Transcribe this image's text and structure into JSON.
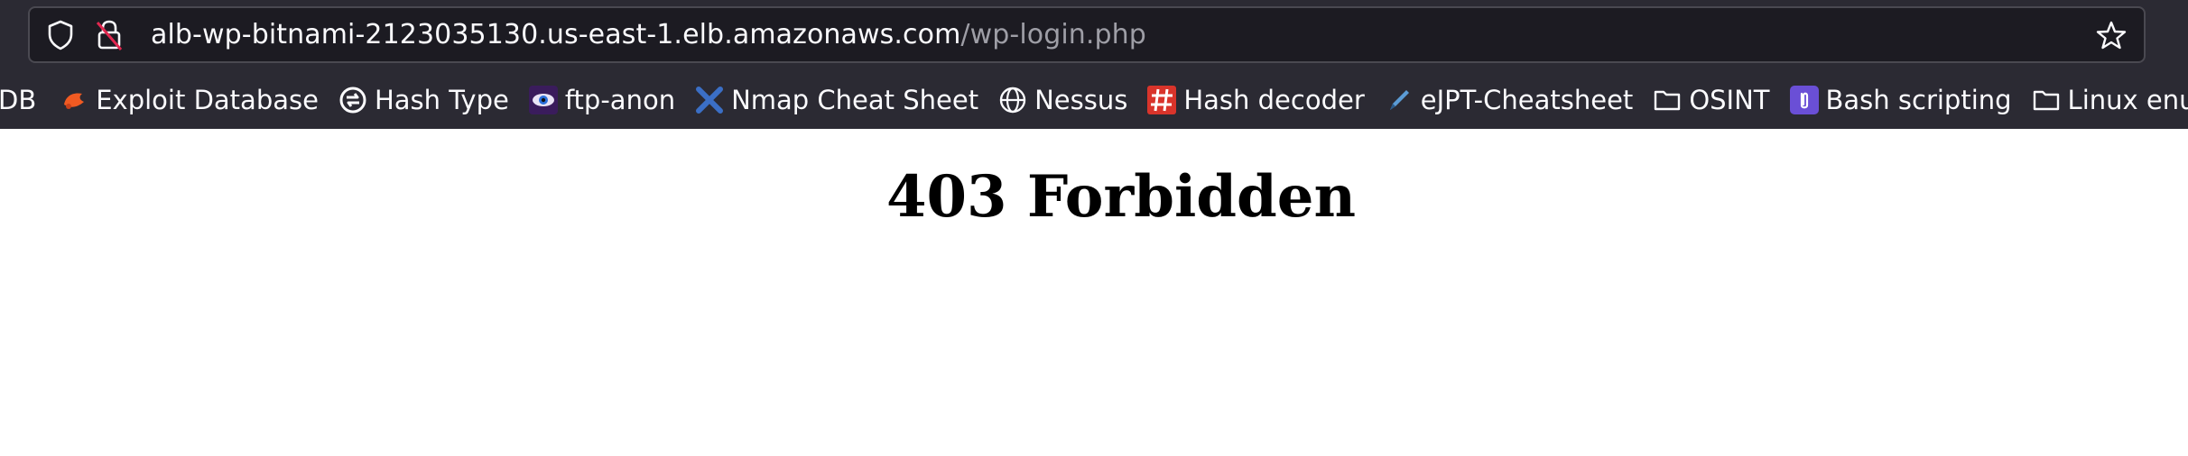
{
  "address_bar": {
    "host": "alb-wp-bitnami-2123035130.us-east-1.elb.amazonaws.com",
    "path": "/wp-login.php"
  },
  "bookmarks": [
    {
      "label": "DB",
      "icon": "none"
    },
    {
      "label": "Exploit Database",
      "icon": "exploit-db-icon"
    },
    {
      "label": "Hash Type",
      "icon": "hash-type-icon"
    },
    {
      "label": "ftp-anon",
      "icon": "eye-icon"
    },
    {
      "label": "Nmap Cheat Sheet",
      "icon": "nmap-x-icon"
    },
    {
      "label": "Nessus",
      "icon": "globe-icon"
    },
    {
      "label": "Hash decoder",
      "icon": "hash-decoder-icon"
    },
    {
      "label": "eJPT-Cheatsheet",
      "icon": "pen-icon"
    },
    {
      "label": "OSINT",
      "icon": "folder-icon"
    },
    {
      "label": "Bash scripting",
      "icon": "clip-icon"
    },
    {
      "label": "Linux enu",
      "icon": "folder-icon"
    }
  ],
  "page": {
    "title": "403 Forbidden"
  },
  "colors": {
    "chrome_bg": "#2b2a33",
    "url_bg": "#1c1b22",
    "text_light": "#fbfbfe",
    "url_path": "#9e9ea6",
    "page_bg": "#ffffff"
  }
}
